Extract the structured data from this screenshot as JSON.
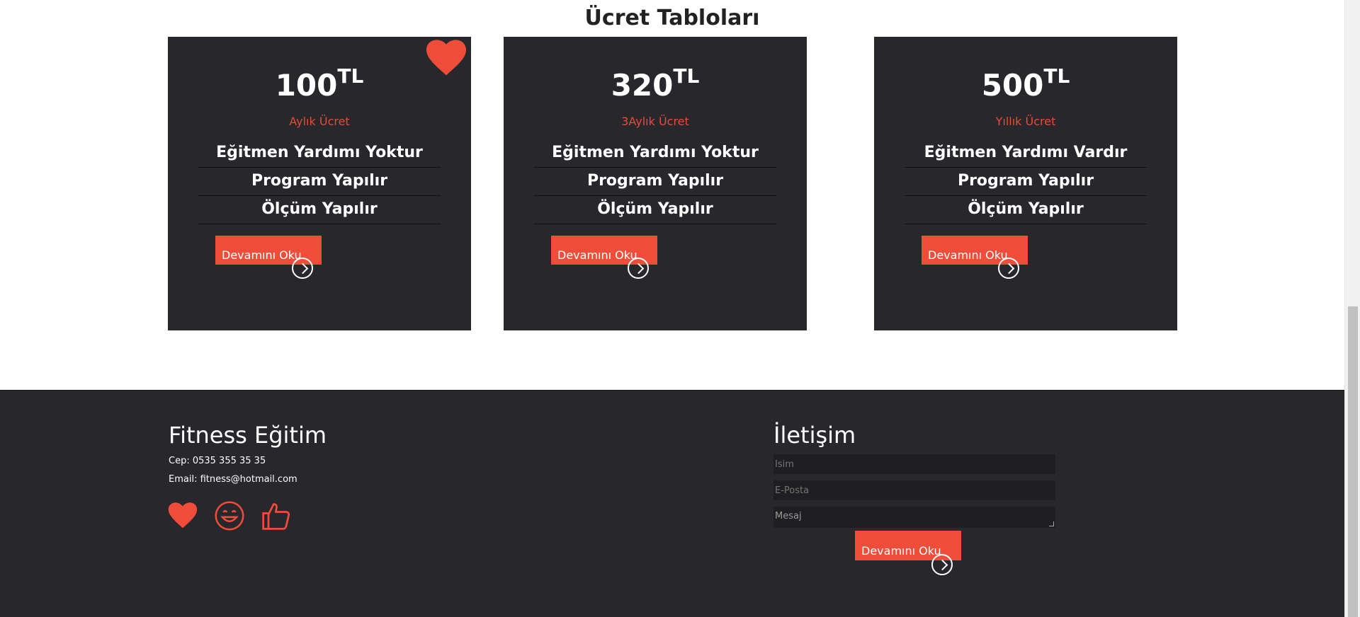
{
  "pricing": {
    "title": "Ücret Tabloları",
    "cards": [
      {
        "price": "100",
        "currency": "TL",
        "period": "Aylık Ücret",
        "features": [
          "Eğitmen Yardımı Yoktur",
          "Program Yapılır",
          "Ölçüm Yapılır"
        ],
        "button": "Devamını Oku",
        "badge": "heart-icon"
      },
      {
        "price": "320",
        "currency": "TL",
        "period": "3Aylık Ücret",
        "features": [
          "Eğitmen Yardımı Yoktur",
          "Program Yapılır",
          "Ölçüm Yapılır"
        ],
        "button": "Devamını Oku"
      },
      {
        "price": "500",
        "currency": "TL",
        "period": "Yıllık Ücret",
        "features": [
          "Eğitmen Yardımı Vardır",
          "Program Yapılır",
          "Ölçüm Yapılır"
        ],
        "button": "Devamını Oku"
      }
    ]
  },
  "footer": {
    "brand": "Fitness Eğitim",
    "phone": "Cep: 0535 355 35 35",
    "email": "Email: fitness@hotmail.com",
    "social_icons": [
      "heart-icon",
      "smile-icon",
      "thumbs-up-icon"
    ],
    "contact": {
      "title": "İletişim",
      "name_placeholder": "İsim",
      "email_placeholder": "E-Posta",
      "message_placeholder": "Mesaj",
      "button": "Devamını Oku"
    }
  },
  "colors": {
    "accent": "#f04c3a",
    "card_bg": "#28272c",
    "field_bg": "#1f1f22"
  }
}
